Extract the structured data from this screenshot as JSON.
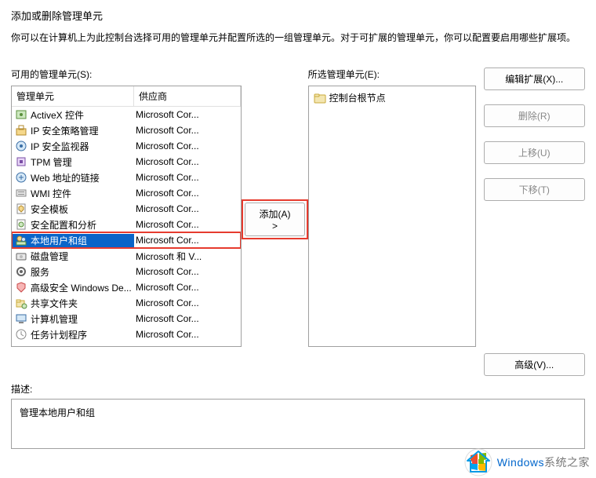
{
  "dialog": {
    "title": "添加或删除管理单元",
    "description": "你可以在计算机上为此控制台选择可用的管理单元并配置所选的一组管理单元。对于可扩展的管理单元，你可以配置要启用哪些扩展项。"
  },
  "available": {
    "label": "可用的管理单元(S):",
    "columns": {
      "name": "管理单元",
      "vendor": "供应商"
    },
    "items": [
      {
        "name": "ActiveX 控件",
        "vendor": "Microsoft Cor...",
        "icon": "activex"
      },
      {
        "name": "IP 安全策略管理",
        "vendor": "Microsoft Cor...",
        "icon": "ipsec"
      },
      {
        "name": "IP 安全监视器",
        "vendor": "Microsoft Cor...",
        "icon": "ipmon"
      },
      {
        "name": "TPM 管理",
        "vendor": "Microsoft Cor...",
        "icon": "tpm"
      },
      {
        "name": "Web 地址的链接",
        "vendor": "Microsoft Cor...",
        "icon": "link"
      },
      {
        "name": "WMI 控件",
        "vendor": "Microsoft Cor...",
        "icon": "wmi"
      },
      {
        "name": "安全模板",
        "vendor": "Microsoft Cor...",
        "icon": "sectpl"
      },
      {
        "name": "安全配置和分析",
        "vendor": "Microsoft Cor...",
        "icon": "seccfg"
      },
      {
        "name": "本地用户和组",
        "vendor": "Microsoft Cor...",
        "icon": "users",
        "selected": true
      },
      {
        "name": "磁盘管理",
        "vendor": "Microsoft 和 V...",
        "icon": "disk"
      },
      {
        "name": "服务",
        "vendor": "Microsoft Cor...",
        "icon": "svc"
      },
      {
        "name": "高级安全 Windows De...",
        "vendor": "Microsoft Cor...",
        "icon": "wfas"
      },
      {
        "name": "共享文件夹",
        "vendor": "Microsoft Cor...",
        "icon": "share"
      },
      {
        "name": "计算机管理",
        "vendor": "Microsoft Cor...",
        "icon": "compmgmt"
      },
      {
        "name": "任务计划程序",
        "vendor": "Microsoft Cor...",
        "icon": "task"
      }
    ]
  },
  "selected": {
    "label": "所选管理单元(E):",
    "root": "控制台根节点"
  },
  "buttons": {
    "add": "添加(A) >",
    "editext": "编辑扩展(X)...",
    "remove": "删除(R)",
    "moveup": "上移(U)",
    "movedown": "下移(T)",
    "advanced": "高级(V)..."
  },
  "description_section": {
    "label": "描述:",
    "text": "管理本地用户和组"
  },
  "watermark": {
    "brand": "Windows",
    "site": "系统之家"
  }
}
